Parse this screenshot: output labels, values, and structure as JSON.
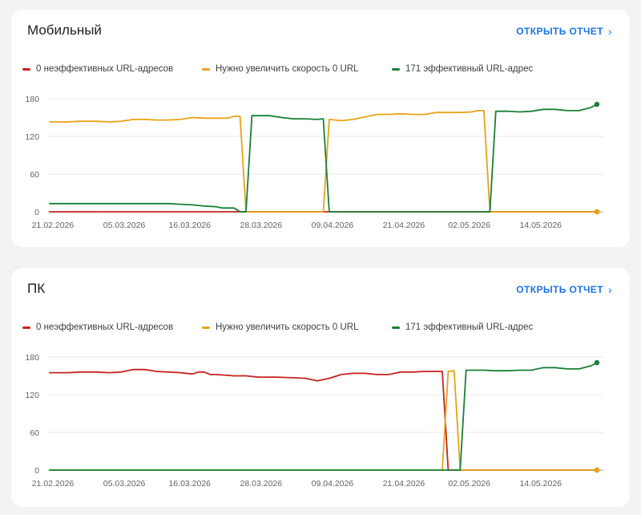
{
  "colors": {
    "ineffective": "#c5221f",
    "needs_speed": "#e8a317",
    "effective": "#188038",
    "link": "#1a73e8",
    "grid": "#e8eaed",
    "baseline": "#9aa0a6"
  },
  "cards": [
    {
      "title": "Мобильный",
      "open_label": "ОТКРЫТЬ ОТЧЕТ",
      "legend": [
        "0 неэффективных URL-адресов",
        "Нужно увеличить скорость 0 URL",
        "171 эффективный URL-адрес"
      ]
    },
    {
      "title": "ПК",
      "open_label": "ОТКРЫТЬ ОТЧЕТ",
      "legend": [
        "0 неэффективных URL-адресов",
        "Нужно увеличить скорость 0 URL",
        "171 эффективный URL-адрес"
      ]
    }
  ],
  "chart_data": [
    {
      "type": "line",
      "title": "Мобильный",
      "x_labels": [
        "21.02.2026",
        "05.03.2026",
        "16.03.2026",
        "28.03.2026",
        "09.04.2026",
        "21.04.2026",
        "02.05.2026",
        "14.05.2026"
      ],
      "label_days": [
        0,
        12,
        23,
        35,
        47,
        59,
        70,
        82
      ],
      "x_range": [
        0,
        92
      ],
      "ylim": [
        0,
        180
      ],
      "yticks": [
        0,
        60,
        120,
        180
      ],
      "grid": true,
      "series": [
        {
          "name": "0 неэффективных URL-адресов",
          "color_key": "ineffective",
          "points": [
            [
              0,
              0
            ],
            [
              92,
              0
            ]
          ]
        },
        {
          "name": "Нужно увеличить скорость 0 URL",
          "color_key": "needs_speed",
          "points": [
            [
              0,
              143
            ],
            [
              3,
              143
            ],
            [
              5,
              144
            ],
            [
              8,
              144
            ],
            [
              10,
              143
            ],
            [
              12,
              144
            ],
            [
              14,
              147
            ],
            [
              16,
              147
            ],
            [
              18,
              146
            ],
            [
              20,
              146
            ],
            [
              22,
              147
            ],
            [
              24,
              150
            ],
            [
              26,
              149
            ],
            [
              28,
              149
            ],
            [
              30,
              149
            ],
            [
              31,
              152
            ],
            [
              32,
              152
            ],
            [
              33,
              0
            ],
            [
              46,
              0
            ],
            [
              47,
              147
            ],
            [
              49,
              145
            ],
            [
              51,
              147
            ],
            [
              53,
              151
            ],
            [
              55,
              155
            ],
            [
              57,
              155
            ],
            [
              59,
              156
            ],
            [
              61,
              155
            ],
            [
              63,
              155
            ],
            [
              65,
              158
            ],
            [
              67,
              158
            ],
            [
              69,
              158
            ],
            [
              71,
              159
            ],
            [
              72,
              161
            ],
            [
              73,
              161
            ],
            [
              74,
              0
            ],
            [
              92,
              0
            ]
          ]
        },
        {
          "name": "171 эффективный URL-адрес",
          "color_key": "effective",
          "points": [
            [
              0,
              13
            ],
            [
              12,
              13
            ],
            [
              20,
              13
            ],
            [
              22,
              12
            ],
            [
              24,
              11
            ],
            [
              26,
              9
            ],
            [
              28,
              8
            ],
            [
              29,
              6
            ],
            [
              31,
              6
            ],
            [
              32,
              0
            ],
            [
              33,
              0
            ],
            [
              34,
              153
            ],
            [
              37,
              153
            ],
            [
              39,
              150
            ],
            [
              41,
              148
            ],
            [
              43,
              148
            ],
            [
              45,
              147
            ],
            [
              46,
              148
            ],
            [
              47,
              0
            ],
            [
              74,
              0
            ],
            [
              75,
              160
            ],
            [
              77,
              160
            ],
            [
              79,
              159
            ],
            [
              81,
              160
            ],
            [
              83,
              163
            ],
            [
              85,
              163
            ],
            [
              87,
              161
            ],
            [
              89,
              161
            ],
            [
              91,
              166
            ],
            [
              92,
              171
            ]
          ]
        }
      ]
    },
    {
      "type": "line",
      "title": "ПК",
      "x_labels": [
        "21.02.2026",
        "05.03.2026",
        "16.03.2026",
        "28.03.2026",
        "09.04.2026",
        "21.04.2026",
        "02.05.2026",
        "14.05.2026"
      ],
      "label_days": [
        0,
        12,
        23,
        35,
        47,
        59,
        70,
        82
      ],
      "x_range": [
        0,
        92
      ],
      "ylim": [
        0,
        180
      ],
      "yticks": [
        0,
        60,
        120,
        180
      ],
      "grid": true,
      "series": [
        {
          "name": "0 неэффективных URL-адресов",
          "color_key": "ineffective",
          "points": [
            [
              0,
              155
            ],
            [
              3,
              155
            ],
            [
              5,
              156
            ],
            [
              8,
              156
            ],
            [
              10,
              155
            ],
            [
              12,
              156
            ],
            [
              14,
              160
            ],
            [
              16,
              160
            ],
            [
              18,
              157
            ],
            [
              20,
              156
            ],
            [
              22,
              155
            ],
            [
              24,
              153
            ],
            [
              25,
              156
            ],
            [
              26,
              156
            ],
            [
              27,
              152
            ],
            [
              28,
              152
            ],
            [
              31,
              150
            ],
            [
              33,
              150
            ],
            [
              35,
              148
            ],
            [
              38,
              148
            ],
            [
              41,
              147
            ],
            [
              43,
              146
            ],
            [
              45,
              142
            ],
            [
              47,
              146
            ],
            [
              49,
              152
            ],
            [
              51,
              154
            ],
            [
              53,
              154
            ],
            [
              55,
              152
            ],
            [
              57,
              152
            ],
            [
              59,
              156
            ],
            [
              61,
              156
            ],
            [
              63,
              157
            ],
            [
              65,
              157
            ],
            [
              66,
              157
            ],
            [
              67,
              0
            ],
            [
              92,
              0
            ]
          ]
        },
        {
          "name": "Нужно увеличить скорость 0 URL",
          "color_key": "needs_speed",
          "points": [
            [
              0,
              0
            ],
            [
              66,
              0
            ],
            [
              67,
              157
            ],
            [
              68,
              158
            ],
            [
              69,
              0
            ],
            [
              92,
              0
            ]
          ]
        },
        {
          "name": "171 эффективный URL-адрес",
          "color_key": "effective",
          "points": [
            [
              0,
              0
            ],
            [
              68,
              0
            ],
            [
              69,
              0
            ],
            [
              70,
              159
            ],
            [
              73,
              159
            ],
            [
              75,
              158
            ],
            [
              77,
              158
            ],
            [
              79,
              159
            ],
            [
              81,
              159
            ],
            [
              83,
              163
            ],
            [
              85,
              163
            ],
            [
              87,
              161
            ],
            [
              89,
              161
            ],
            [
              91,
              166
            ],
            [
              92,
              171
            ]
          ]
        }
      ]
    }
  ]
}
